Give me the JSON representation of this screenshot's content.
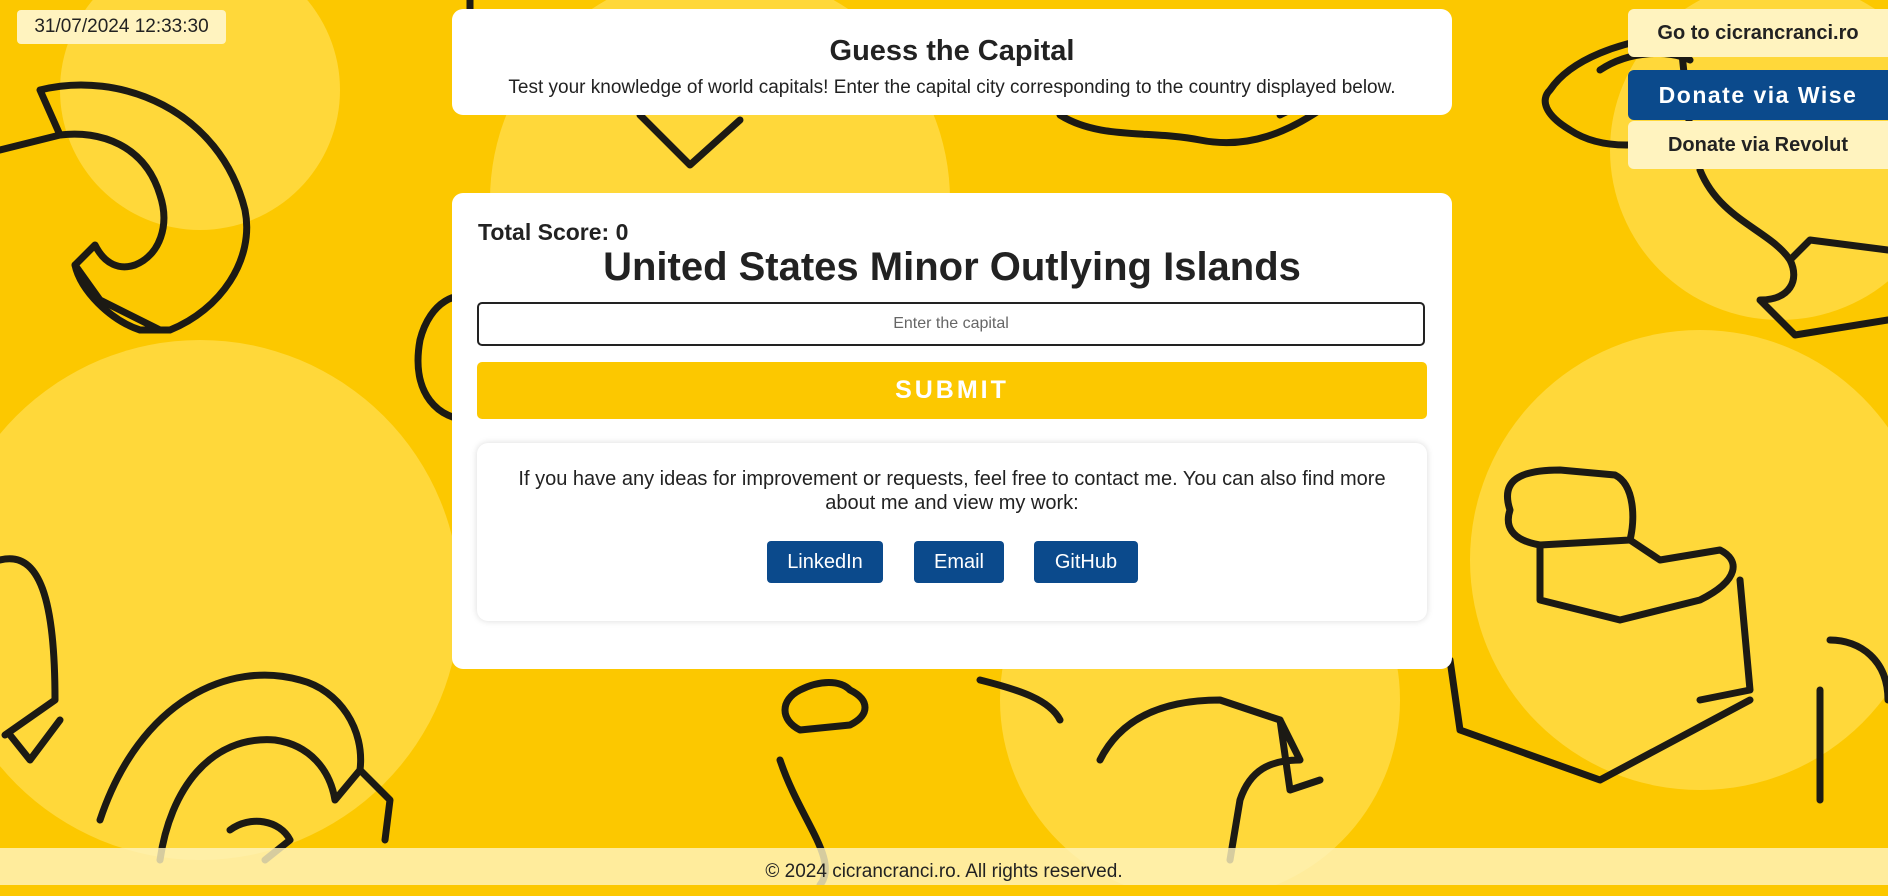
{
  "datetime": "31/07/2024 12:33:30",
  "header": {
    "title": "Guess the Capital",
    "subtitle": "Test your knowledge of world capitals! Enter the capital city corresponding to the country displayed below."
  },
  "side_buttons": {
    "site": "Go to cicrancranci.ro",
    "wise": "Donate via Wise",
    "revolut": "Donate via Revolut"
  },
  "game": {
    "score_label": "Total Score: 0",
    "country": "United States Minor Outlying Islands",
    "input_placeholder": "Enter the capital",
    "input_value": "",
    "submit_label": "SUBMIT"
  },
  "contact": {
    "text": "If you have any ideas for improvement or requests, feel free to contact me. You can also find more about me and view my work:",
    "links": [
      "LinkedIn",
      "Email",
      "GitHub"
    ]
  },
  "footer": "© 2024 cicrancranci.ro. All rights reserved.",
  "colors": {
    "background": "#fcc800",
    "accent_blue": "#0b4a8c",
    "pale_yellow": "#fff3bf"
  }
}
